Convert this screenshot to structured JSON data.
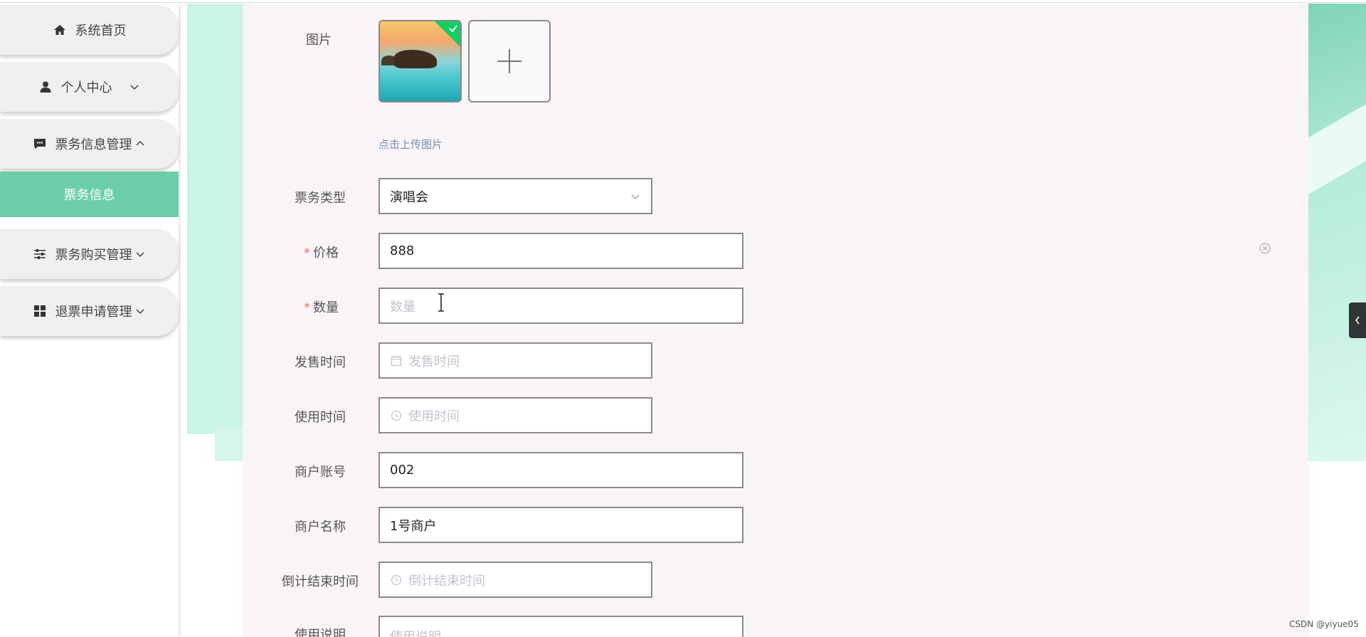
{
  "sidebar": {
    "items": [
      {
        "label": "系统首页",
        "icon": "home-icon"
      },
      {
        "label": "个人中心",
        "icon": "user-icon",
        "arrow": "chevron-down-icon"
      },
      {
        "label": "票务信息管理",
        "icon": "message-icon",
        "arrow": "chevron-up-icon"
      },
      {
        "label": "票务购买管理",
        "icon": "sliders-icon",
        "arrow": "chevron-down-icon"
      },
      {
        "label": "退票申请管理",
        "icon": "grid-icon",
        "arrow": "chevron-down-icon"
      }
    ],
    "active_sub": "票务信息"
  },
  "form": {
    "image": {
      "label": "图片",
      "hint": "点击上传图片"
    },
    "ticket_type": {
      "label": "票务类型",
      "value": "演唱会"
    },
    "price": {
      "label": "价格",
      "value": "888",
      "required": true
    },
    "quantity": {
      "label": "数量",
      "placeholder": "数量",
      "required": true
    },
    "sale_time": {
      "label": "发售时间",
      "placeholder": "发售时间"
    },
    "use_time": {
      "label": "使用时间",
      "placeholder": "使用时间"
    },
    "merchant_account": {
      "label": "商户账号",
      "value": "002"
    },
    "merchant_name": {
      "label": "商户名称",
      "value": "1号商户"
    },
    "countdown_end": {
      "label": "倒计结束时间",
      "placeholder": "倒计结束时间"
    },
    "instructions": {
      "label": "使用说明",
      "placeholder": "使用说明"
    }
  },
  "watermark": "CSDN @yiyue05",
  "colors": {
    "accent": "#6dcfa9",
    "required": "#f56c6c",
    "card": "#f8f4f8",
    "bg_panel": "#c8f3e6"
  }
}
